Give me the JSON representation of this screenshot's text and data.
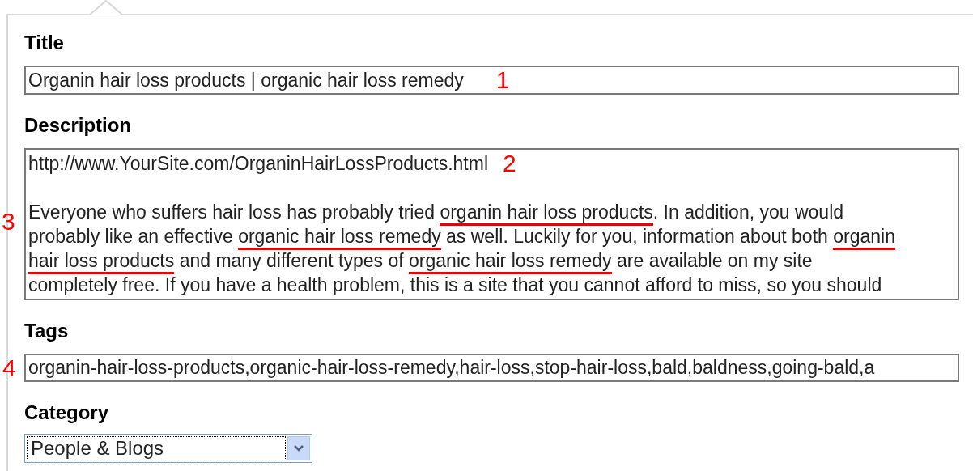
{
  "title_field": {
    "label": "Title",
    "value": "Organin hair loss products | organic hair loss remedy",
    "annotation": "1"
  },
  "description_field": {
    "label": "Description",
    "url": "http://www.YourSite.com/OrganinHairLossProducts.html",
    "url_annotation": "2",
    "annotation": "3",
    "lines": [
      [
        {
          "text": "Everyone who suffers hair loss has probably tried ",
          "underlined": false
        },
        {
          "text": "organin hair loss products",
          "underlined": true
        },
        {
          "text": ". In addition, you would",
          "underlined": false
        }
      ],
      [
        {
          "text": "probably like an effective ",
          "underlined": false
        },
        {
          "text": "organic hair loss remedy",
          "underlined": true
        },
        {
          "text": " as well. Luckily for you, information about both ",
          "underlined": false
        },
        {
          "text": "organin",
          "underlined": true
        }
      ],
      [
        {
          "text": "hair loss products",
          "underlined": true
        },
        {
          "text": " and many different types of ",
          "underlined": false
        },
        {
          "text": "organic hair loss remedy",
          "underlined": true
        },
        {
          "text": " are available on my site",
          "underlined": false
        }
      ],
      [
        {
          "text": "completely free. If you have a health problem, this is a site that you cannot afford to miss, so you should",
          "underlined": false
        }
      ]
    ]
  },
  "tags_field": {
    "label": "Tags",
    "value": "organin-hair-loss-products,organic-hair-loss-remedy,hair-loss,stop-hair-loss,bald,baldness,going-bald,a",
    "annotation": "4"
  },
  "category_field": {
    "label": "Category",
    "value": "People & Blogs"
  }
}
